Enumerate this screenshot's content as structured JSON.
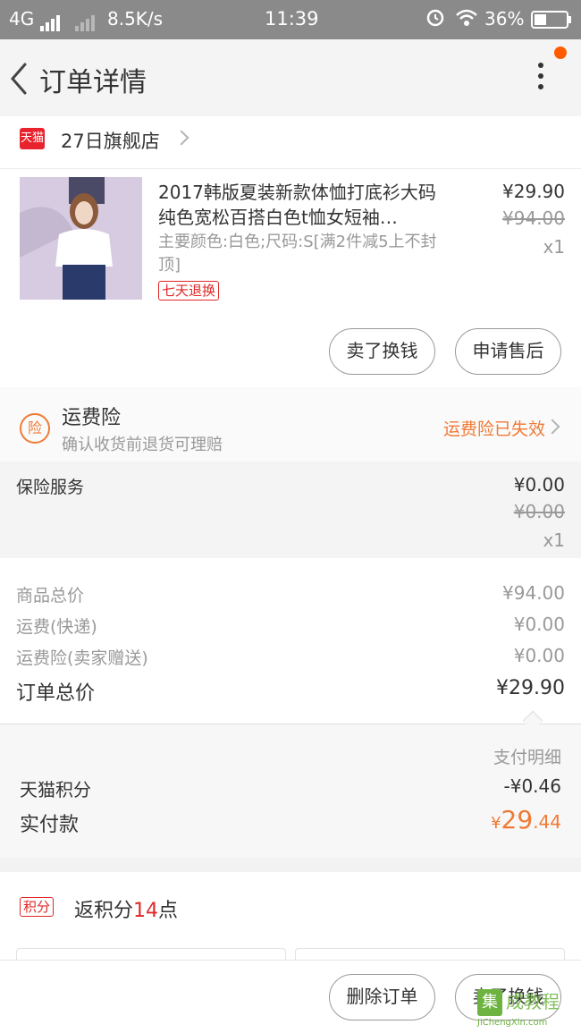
{
  "status_bar": {
    "network": "4G",
    "speed": "8.5K/s",
    "time": "11:39",
    "battery": "36%"
  },
  "nav": {
    "title": "订单详情",
    "icons": [
      "back-arrow-icon",
      "more-vertical-icon"
    ]
  },
  "shop": {
    "logo_text": "天猫",
    "name": "27日旗舰店"
  },
  "product": {
    "title": "2017韩版夏装新款体恤打底衫大码纯色宽松百搭白色t恤女短袖…",
    "sku": "主要颜色:白色;尺码:S[满2件减5上不封顶]",
    "tag": "七天退换",
    "price": "¥29.90",
    "original_price": "¥94.00",
    "quantity": "x1",
    "buttons": [
      "卖了换钱",
      "申请售后"
    ]
  },
  "insurance": {
    "icon_text": "险",
    "title": "运费险",
    "subtitle": "确认收货前退货可理赔",
    "status": "运费险已失效"
  },
  "service": {
    "label": "保险服务",
    "price": "¥0.00",
    "original_price": "¥0.00",
    "quantity": "x1"
  },
  "summary": {
    "rows": [
      {
        "label": "商品总价",
        "value": "¥94.00"
      },
      {
        "label": "运费(快递)",
        "value": "¥0.00"
      },
      {
        "label": "运费险(卖家赠送)",
        "value": "¥0.00"
      }
    ],
    "total_label": "订单总价",
    "total_value": "¥29.90"
  },
  "payment": {
    "detail_label": "支付明细",
    "points_label": "天猫积分",
    "points_value": "-¥0.46",
    "paid_label": "实付款",
    "paid_currency": "¥",
    "paid_int": "29",
    "paid_dec": ".44"
  },
  "rewards": {
    "tag": "积分",
    "text_prefix": "返积分",
    "points": "14",
    "text_suffix": "点"
  },
  "bottom": {
    "buttons": [
      "删除订单",
      "卖了换钱"
    ]
  },
  "watermark": {
    "box": "集",
    "text": "成教程",
    "url": "JiChengXin.com"
  },
  "colors": {
    "accent_orange": "#f07a35",
    "tmall_red": "#e8232e",
    "tag_red": "#e02727",
    "notification_dot": "#ff5a00"
  }
}
